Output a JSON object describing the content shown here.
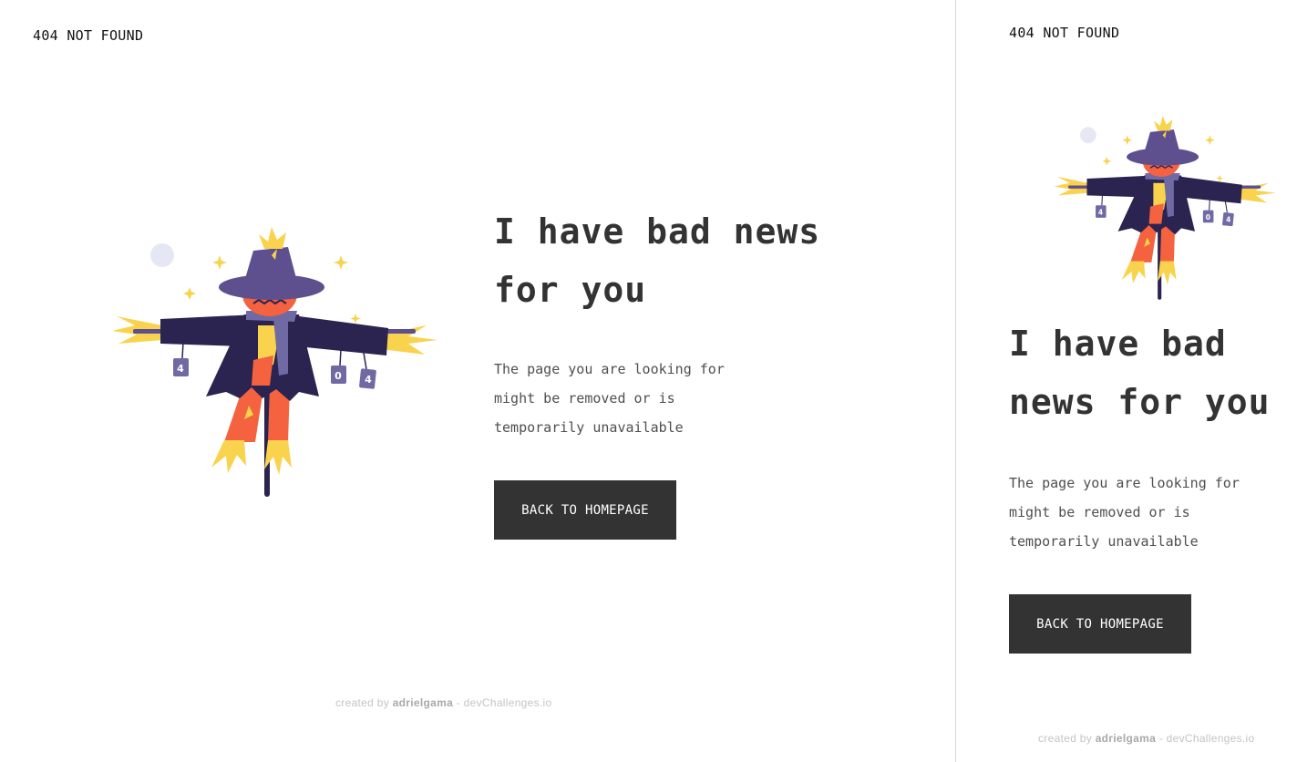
{
  "brand": "404 NOT FOUND",
  "headline": "I have bad news for you",
  "message": "The page you are looking for might be removed or is temporarily unavailable",
  "cta_label": "BACK TO HOMEPAGE",
  "footer": {
    "prefix": "created by",
    "author": "adrielgama",
    "suffix": "- devChallenges.io"
  },
  "illustration": {
    "can_digits": [
      "4",
      "0",
      "4"
    ],
    "colors": {
      "coat": "#2b2350",
      "hat": "#5e4f8e",
      "pumpkin": "#f5623f",
      "straw": "#f9d34d",
      "scarf": "#6f6aa3",
      "pole": "#2b2350",
      "moon": "#e5e8f4"
    }
  }
}
